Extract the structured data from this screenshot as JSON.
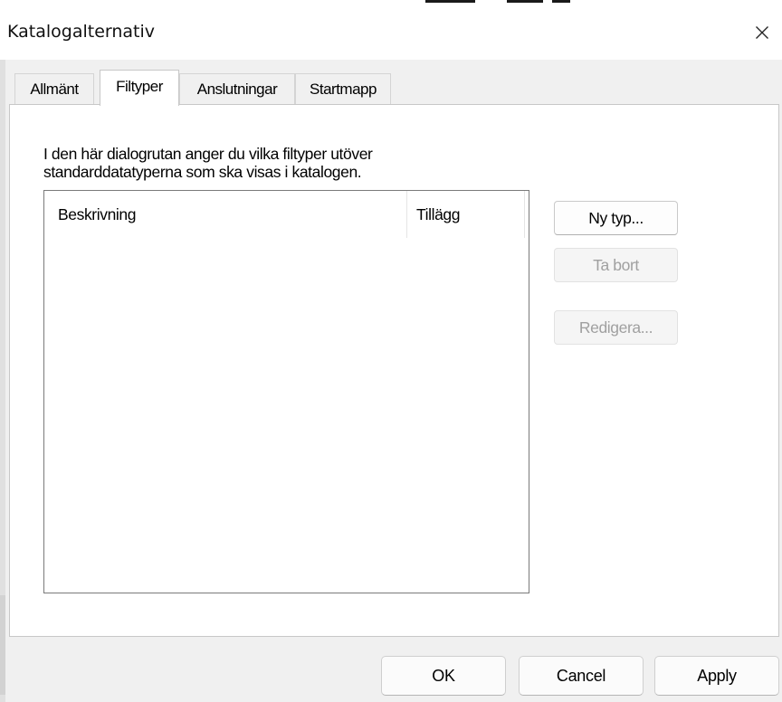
{
  "window": {
    "title": "Katalogalternativ"
  },
  "tabs": [
    {
      "label": "Allmänt",
      "active": false
    },
    {
      "label": "Filtyper",
      "active": true
    },
    {
      "label": "Anslutningar",
      "active": false
    },
    {
      "label": "Startmapp",
      "active": false
    }
  ],
  "filetypes": {
    "description_line1": "I den här dialogrutan anger du vilka filtyper utöver",
    "description_line2": "standarddatatyperna som ska visas i katalogen.",
    "columns": {
      "description": "Beskrivning",
      "extension": "Tillägg"
    },
    "rows": [],
    "buttons": {
      "new_type": "Ny typ...",
      "remove": "Ta bort",
      "edit": "Redigera..."
    }
  },
  "footer": {
    "ok": "OK",
    "cancel": "Cancel",
    "apply": "Apply"
  },
  "colors": {
    "dialog_background": "#f0f0f0",
    "panel_background": "#ffffff",
    "disabled_text": "#a0a0a0"
  }
}
